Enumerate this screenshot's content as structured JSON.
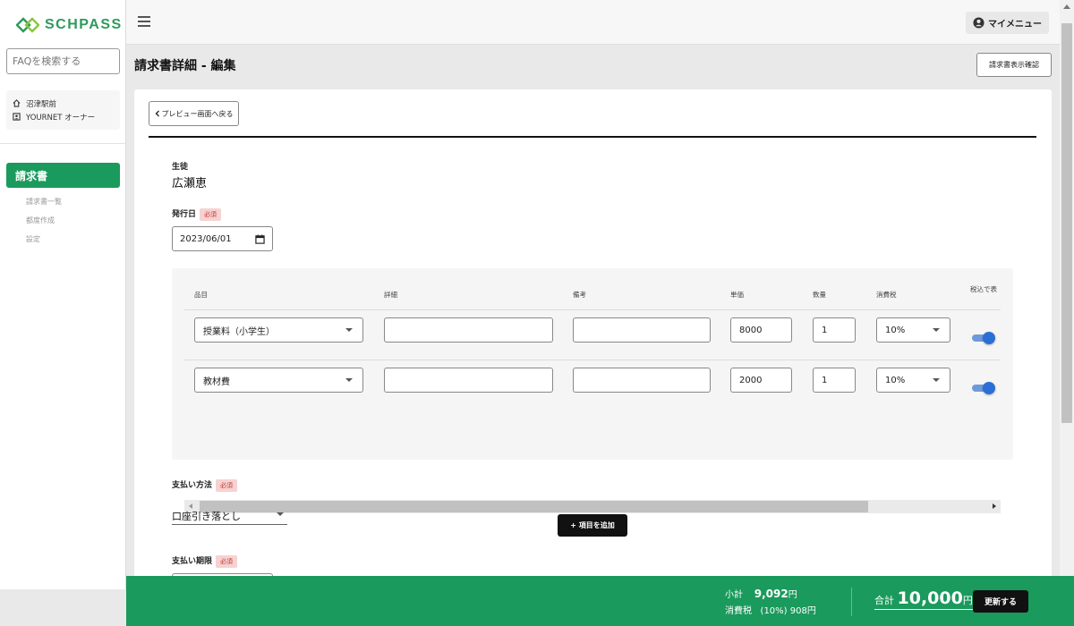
{
  "brand": {
    "name": "SCHPASS",
    "color": "#2e9a5c"
  },
  "sidebar": {
    "search_placeholder": "FAQを検索する",
    "school": "沼津駅前",
    "user": "YOURNET オーナー",
    "active_item": "請求書",
    "sub_items": [
      "請求書一覧",
      "都度作成",
      "設定"
    ]
  },
  "header": {
    "my_menu": "マイメニュー"
  },
  "page": {
    "title": "請求書詳細 - 編集",
    "view_button": "請求書表示確認",
    "back_button": "プレビュー画面へ戻る"
  },
  "form": {
    "student_label": "生徒",
    "student_name": "広瀬恵",
    "issue_date_label": "発行日",
    "required": "必須",
    "issue_date": "2023/06/01",
    "payment_method_label": "支払い方法",
    "payment_method": "口座引き落とし",
    "payment_due_label": "支払い期限"
  },
  "items_table": {
    "headers": [
      "品目",
      "詳細",
      "備考",
      "単価",
      "数量",
      "消費税",
      "税込で表"
    ],
    "rows": [
      {
        "item": "授業料（小学生）",
        "detail": "",
        "note": "",
        "unit_price": "8000",
        "qty": "1",
        "tax": "10%",
        "tax_included": true
      },
      {
        "item": "教材費",
        "detail": "",
        "note": "",
        "unit_price": "2000",
        "qty": "1",
        "tax": "10%",
        "tax_included": true
      }
    ],
    "add_button": "+ 項目を追加"
  },
  "footer": {
    "subtotal_label": "小計",
    "subtotal_value": "9,092",
    "yen": "円",
    "tax_label": "消費税",
    "tax_rate": "(10%)",
    "tax_value": "908円",
    "total_label": "合計",
    "total_value": "10,000",
    "update_button": "更新する"
  },
  "colors": {
    "accent_green": "#1a9a5c",
    "toggle_blue": "#2a6fd6",
    "required_badge": "#f6d2d2"
  }
}
